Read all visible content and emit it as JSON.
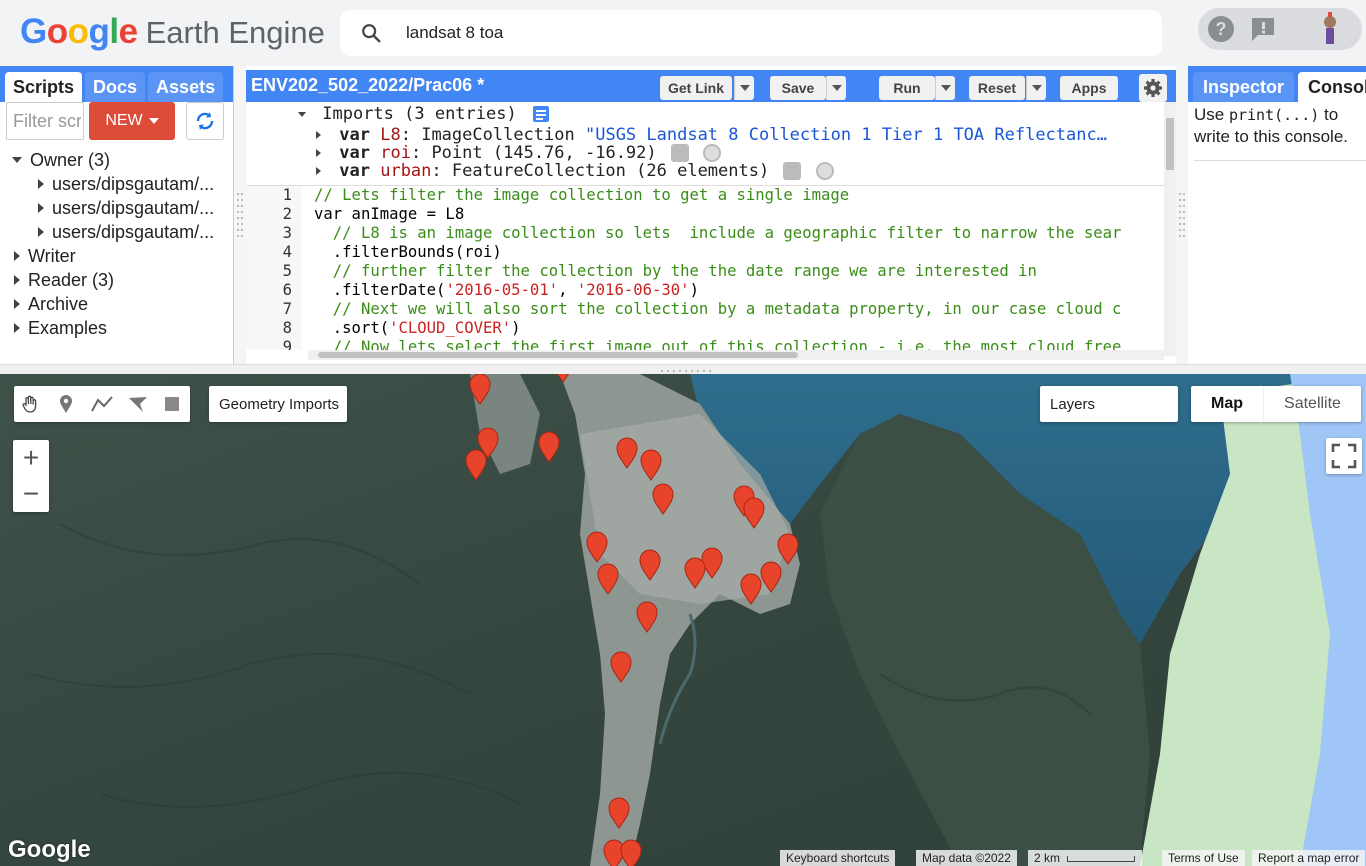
{
  "header": {
    "logo_google": [
      "G",
      "o",
      "o",
      "g",
      "l",
      "e"
    ],
    "logo_colors": [
      "#4285f4",
      "#ea4335",
      "#fbbc05",
      "#4285f4",
      "#34a853",
      "#ea4335"
    ],
    "logo_product": "Earth Engine",
    "search_value": "landsat 8 toa",
    "search_icon": "search-icon",
    "help_icon": "help-icon",
    "feedback_icon": "feedback-icon",
    "avatar_icon": "avatar"
  },
  "left_panel": {
    "tabs": [
      "Scripts",
      "Docs",
      "Assets"
    ],
    "filter_placeholder": "Filter scripts...",
    "filter_value": "Filter scri",
    "new_button": "NEW",
    "tree": [
      {
        "label": "Owner (3)",
        "expanded": true,
        "level": 0
      },
      {
        "label": "users/dipsgautam/...",
        "expanded": false,
        "level": 1
      },
      {
        "label": "users/dipsgautam/...",
        "expanded": false,
        "level": 1
      },
      {
        "label": "users/dipsgautam/...",
        "expanded": false,
        "level": 1
      },
      {
        "label": "Writer",
        "expanded": false,
        "level": 0
      },
      {
        "label": "Reader (3)",
        "expanded": false,
        "level": 0
      },
      {
        "label": "Archive",
        "expanded": false,
        "level": 0
      },
      {
        "label": "Examples",
        "expanded": false,
        "level": 0
      }
    ]
  },
  "editor": {
    "title": "ENV202_502_2022/Prac06 *",
    "buttons": {
      "get_link": "Get Link",
      "save": "Save",
      "run": "Run",
      "reset": "Reset",
      "apps": "Apps"
    },
    "imports_header": "Imports (3 entries)",
    "imports": [
      {
        "kw": "var",
        "name": "L8",
        "sep": ":",
        "type": "ImageCollection",
        "value": "\"USGS Landsat 8 Collection 1 Tier 1 TOA Reflectanc…"
      },
      {
        "kw": "var",
        "name": "roi",
        "sep": ":",
        "type": "Point",
        "value": "(145.76, -16.92)"
      },
      {
        "kw": "var",
        "name": "urban",
        "sep": ":",
        "type": "FeatureCollection",
        "value": "(26 elements)"
      }
    ],
    "line_numbers": [
      "1",
      "2",
      "3",
      "4",
      "5",
      "6",
      "7",
      "8",
      "9"
    ],
    "code_lines": [
      "// Lets filter the image collection to get a single image",
      "var anImage = L8",
      "  // L8 is an image collection so lets  include a geographic filter to narrow the sear",
      "  .filterBounds(roi)",
      "  // further filter the collection by the the date range we are interested in",
      "  .filterDate('2016-05-01', '2016-06-30')",
      "  // Next we will also sort the collection by a metadata property, in our case cloud c",
      "  .sort('CLOUD_COVER')",
      "  // Now lets select the first image out of this collection - i.e. the most cloud free"
    ]
  },
  "right_panel": {
    "tabs": [
      "Inspector",
      "Console"
    ],
    "console_prefix": "Use ",
    "console_code": "print(...)",
    "console_suffix": " to write to this console."
  },
  "map": {
    "geometry_imports": "Geometry Imports",
    "layers": "Layers",
    "map_type": [
      "Map",
      "Satellite"
    ],
    "zoom_in": "+",
    "zoom_out": "−",
    "google": "Google",
    "attribution": {
      "keyboard": "Keyboard shortcuts",
      "mapdata": "Map data ©2022",
      "scale": "2 km",
      "terms": "Terms of Use",
      "report": "Report a map error"
    },
    "marker_color": "#e8442c"
  }
}
